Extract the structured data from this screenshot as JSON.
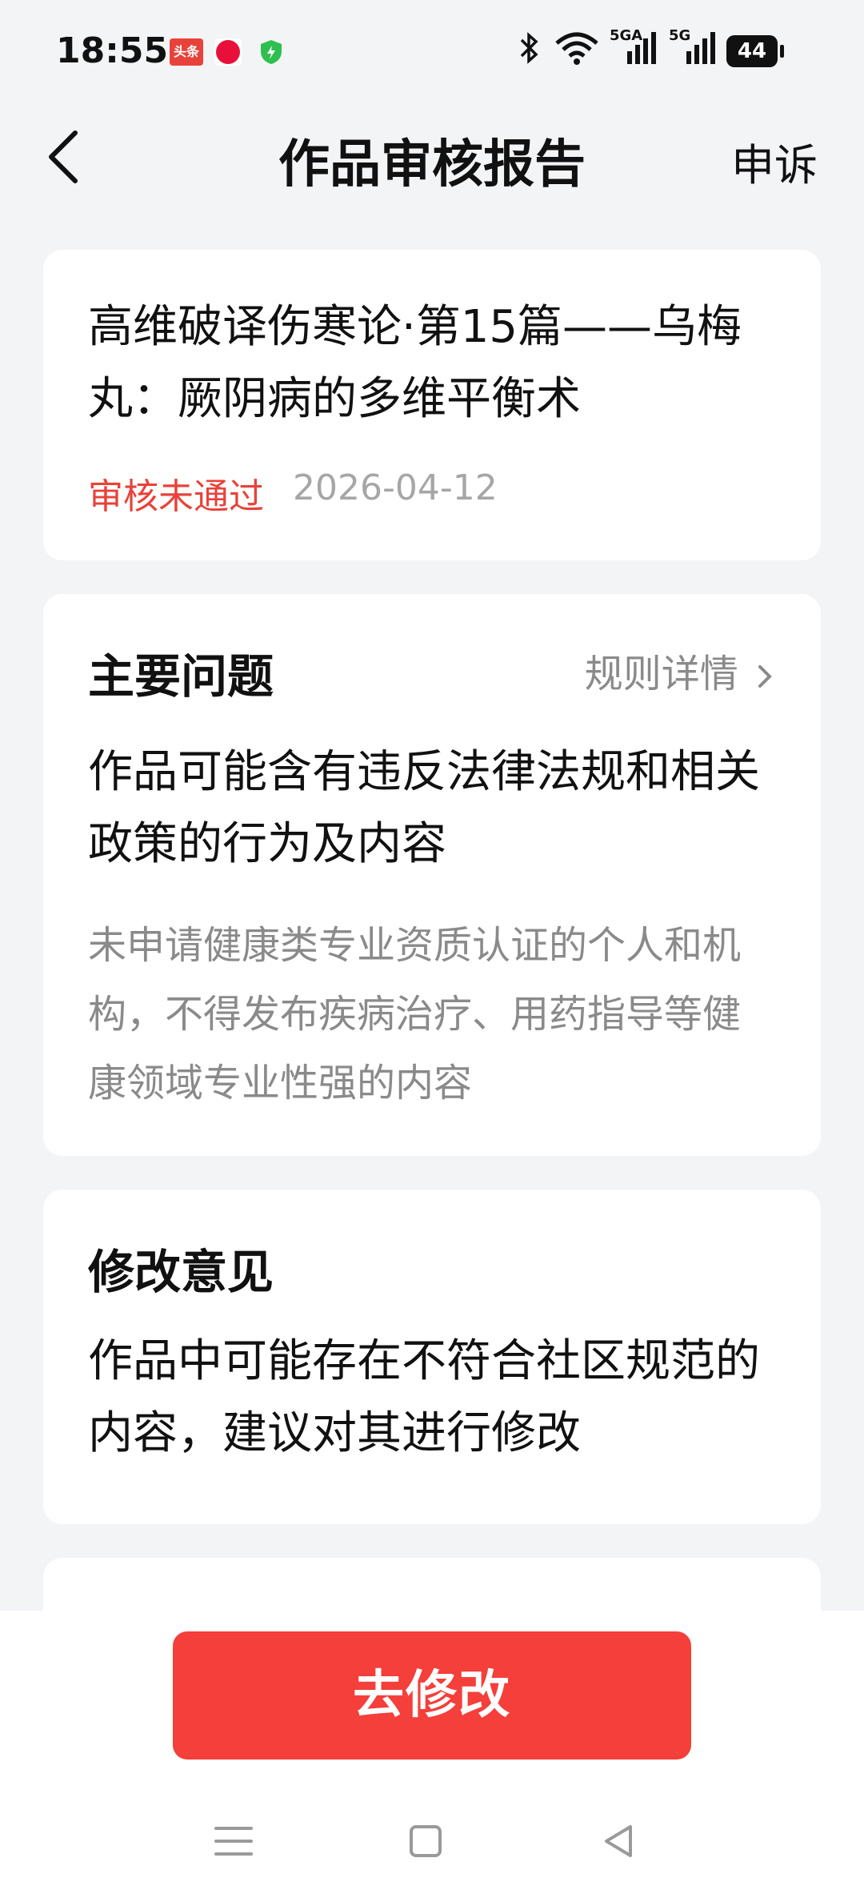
{
  "status_bar": {
    "time": "18:55",
    "notification_app": "头条",
    "signal1": "5GA",
    "signal2": "5G",
    "battery": "44"
  },
  "header": {
    "title": "作品审核报告",
    "appeal": "申诉"
  },
  "article": {
    "title": "高维破译伤寒论·第15篇——乌梅丸：厥阴病的多维平衡术",
    "status": "审核未通过",
    "date": "2026-04-12"
  },
  "main_issue": {
    "heading": "主要问题",
    "rules_link": "规则详情",
    "title": "作品可能含有违反法律法规和相关政策的行为及内容",
    "description": "未申请健康类专业资质认证的个人和机构，不得发布疾病治疗、用药指导等健康领域专业性强的内容"
  },
  "suggestion": {
    "heading": "修改意见",
    "text": "作品中可能存在不符合社区规范的内容，建议对其进行修改"
  },
  "action": {
    "edit_label": "去修改"
  },
  "colors": {
    "accent": "#f43f3b",
    "status_red": "#e8423a",
    "background": "#f3f4f6"
  }
}
